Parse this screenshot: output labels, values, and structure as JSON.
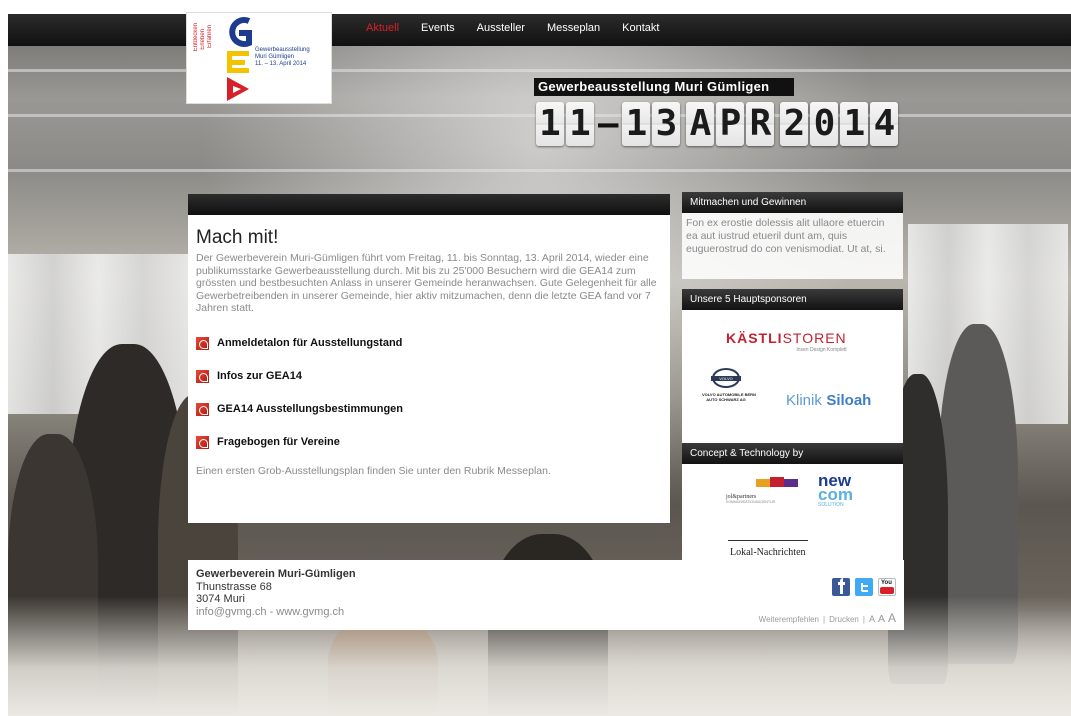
{
  "nav": {
    "items": [
      "Aktuell",
      "Events",
      "Aussteller",
      "Messeplan",
      "Kontakt"
    ],
    "active_index": 0
  },
  "logo": {
    "letters": "GEA",
    "vertical_words": [
      "Entdecken",
      "Erleben",
      "Erfahren"
    ],
    "info_lines": [
      "Gewerbeausstellung",
      "Muri Gümligen",
      "11. – 13. April 2014"
    ]
  },
  "event": {
    "title": "Gewerbeausstellung Muri Gümligen",
    "date_start": "11",
    "date_separator": "–",
    "date_end": "13",
    "month": "APR",
    "year": "2014"
  },
  "main": {
    "heading": "Mach mit!",
    "intro": "Der Gewerbeverein Muri-Gümligen führt vom Freitag, 11. bis Sonntag, 13. April 2014, wieder eine publikumsstarke Gewerbeausstellung durch. Mit bis zu 25'000 Besuchern wird die GEA14 zum grössten und bestbesuchten Anlass in unserer Gemeinde heranwachsen. Gute Gelegenheit für alle Gewerbetreibenden in unserer Gemeinde, hier aktiv mitzumachen, denn die letzte GEA fand vor 7 Jahren statt.",
    "documents": [
      "Anmeldetalon für Ausstellungstand",
      "Infos zur GEA14",
      "GEA14 Ausstellungsbestimmungen",
      "Fragebogen für Vereine"
    ],
    "outro": "Einen ersten Grob-Ausstellungsplan finden Sie unter den Rubrik Messeplan."
  },
  "sidebar": {
    "contest": {
      "title": "Mitmachen und Gewinnen",
      "text": "Fon ex erostie dolessis alit ullaore etuercin ea aut iustrud etueril dunt am, quis euguerostrud do con venismodiat. Ut at, si."
    },
    "sponsors": {
      "title": "Unsere 5 Hauptsponsoren",
      "kaestli_a": "KÄSTLI",
      "kaestli_b": "STOREN",
      "kaestli_tag": "Insen Design Komplett",
      "volvo_badge": "VOLVO",
      "volvo_lines": [
        "VOLVO AUTOMOBILE BERN",
        "AUTO SCHWARZ AG"
      ],
      "klinik_a": "Klinik",
      "klinik_b": "Siloah"
    },
    "technology": {
      "title": "Concept & Technology by",
      "jol": "jol&partners",
      "jol_sub": "KOMMUNIKATIONSAGENTUR",
      "newcom_a": "new",
      "newcom_b": "com",
      "newcom_c": "SOLUTION",
      "lokal": "Lokal-Nachrichten"
    }
  },
  "footer": {
    "org_name": "Gewerbeverein Muri-Gümligen",
    "street": "Thunstrasse 68",
    "city": "3074 Muri",
    "email": "info@gvmg.ch",
    "link_separator": " - ",
    "website": "www.gvmg.ch",
    "social": [
      "facebook-icon",
      "twitter-icon",
      "youtube-icon"
    ],
    "youtube_label": "You",
    "tools": {
      "recommend": "Weiterempfehlen",
      "print": "Drucken",
      "separator": "|",
      "font_sizes": [
        "A",
        "A",
        "A"
      ]
    }
  },
  "colors": {
    "accent_red": "#d8202a",
    "logo_blue": "#1d3c8f",
    "logo_yellow": "#f2c400",
    "bar_dark": "#121212"
  }
}
